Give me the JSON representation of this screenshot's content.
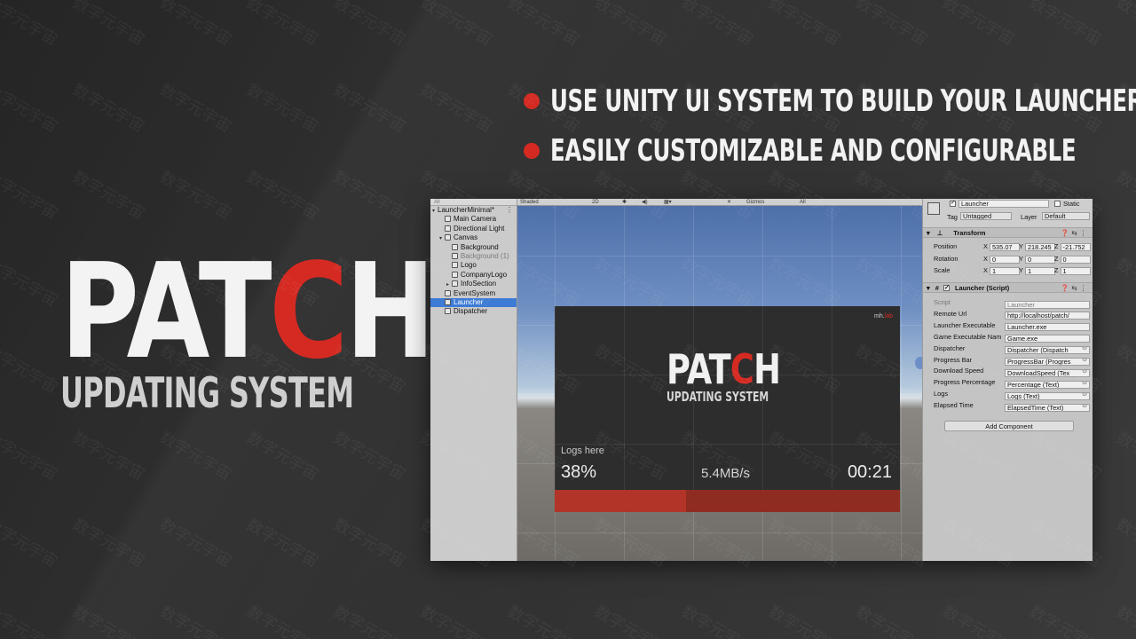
{
  "left_logo": {
    "patch_pre": "PAT",
    "patch_red": "C",
    "patch_post": "H",
    "subtitle": "UPDATING SYSTEM"
  },
  "bullets": [
    "USE UNITY UI SYSTEM TO BUILD YOUR LAUNCHER",
    "EASILY CUSTOMIZABLE AND CONFIGURABLE"
  ],
  "colors": {
    "accent": "#d42a22",
    "background": "#2f2f2f",
    "selection": "#3d7bd5"
  },
  "hierarchy": {
    "search_placeholder": "All",
    "items": [
      {
        "label": "LauncherMinimal*",
        "indent": 0,
        "kind": "scene"
      },
      {
        "label": "Main Camera",
        "indent": 1,
        "kind": "object"
      },
      {
        "label": "Directional Light",
        "indent": 1,
        "kind": "object"
      },
      {
        "label": "Canvas",
        "indent": 1,
        "kind": "parent"
      },
      {
        "label": "Background",
        "indent": 2,
        "kind": "object"
      },
      {
        "label": "Background (1)",
        "indent": 2,
        "kind": "dim"
      },
      {
        "label": "Logo",
        "indent": 2,
        "kind": "object"
      },
      {
        "label": "CompanyLogo",
        "indent": 2,
        "kind": "object"
      },
      {
        "label": "InfoSection",
        "indent": 2,
        "kind": "collapsed"
      },
      {
        "label": "EventSystem",
        "indent": 1,
        "kind": "object"
      },
      {
        "label": "Launcher",
        "indent": 1,
        "kind": "selected"
      },
      {
        "label": "Dispatcher",
        "indent": 1,
        "kind": "object"
      }
    ]
  },
  "scene": {
    "shading_mode": "Shaded",
    "mode_2d": "2D",
    "gizmos": "Gizmos",
    "search_placeholder": "All",
    "launcher_preview": {
      "lab_logo_pre": "mh.",
      "lab_logo_red": "lab",
      "logo_pre": "PAT",
      "logo_red": "C",
      "logo_post": "H",
      "logo_sub": "UPDATING SYSTEM",
      "logs": "Logs here",
      "percentage": "38%",
      "progress": 0.38,
      "speed": "5.4MB/s",
      "elapsed": "00:21"
    }
  },
  "inspector": {
    "object_name": "Launcher",
    "static_label": "Static",
    "tag_label": "Tag",
    "tag_value": "Untagged",
    "layer_label": "Layer",
    "layer_value": "Default",
    "transform": {
      "title": "Transform",
      "position_label": "Position",
      "position": [
        "535.07",
        "218.245",
        "-21.752"
      ],
      "rotation_label": "Rotation",
      "rotation": [
        "0",
        "0",
        "0"
      ],
      "scale_label": "Scale",
      "scale": [
        "1",
        "1",
        "1"
      ]
    },
    "script_component": {
      "title": "Launcher (Script)",
      "fields": [
        {
          "label": "Script",
          "value": "Launcher"
        },
        {
          "label": "Remote Url",
          "value": "http://localhost/patch/"
        },
        {
          "label": "Launcher Executable",
          "value": "Launcher.exe"
        },
        {
          "label": "Game Executable Nam",
          "value": "Game.exe"
        },
        {
          "label": "Dispatcher",
          "value": "Dispatcher (Dispatch"
        },
        {
          "label": "Progress Bar",
          "value": "ProgressBar (Progres"
        },
        {
          "label": "Download Speed",
          "value": "DownloadSpeed (Tex"
        },
        {
          "label": "Progress Percentage",
          "value": "Percentage (Text)"
        },
        {
          "label": "Logs",
          "value": "Logs (Text)"
        },
        {
          "label": "Elapsed Time",
          "value": "ElapsedTime (Text)"
        }
      ]
    },
    "add_component": "Add Component"
  },
  "watermark": "数字元宇宙"
}
